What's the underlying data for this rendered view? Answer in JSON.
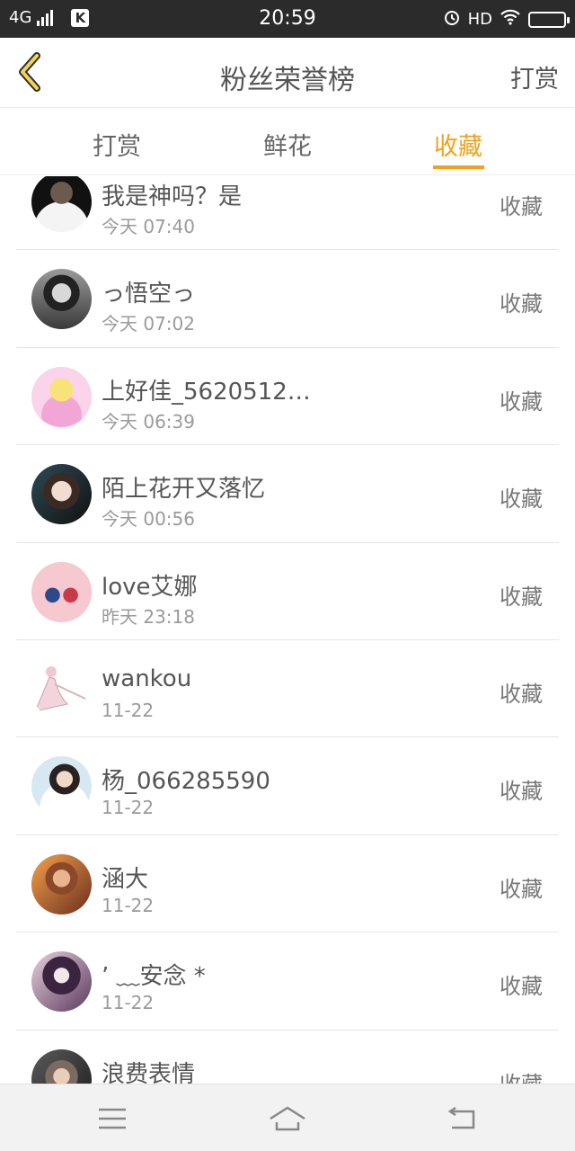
{
  "status_bar": {
    "network": "4G",
    "time": "20:59",
    "hd": "HD",
    "icons": [
      "signal-icon",
      "k-app-icon",
      "alarm-icon",
      "wifi-icon",
      "battery-icon"
    ],
    "k_label": "K"
  },
  "header": {
    "title": "粉丝荣誉榜",
    "right_action": "打赏",
    "back_icon": "chevron-left-icon"
  },
  "tabs": {
    "items": [
      {
        "label": "打赏"
      },
      {
        "label": "鲜花"
      },
      {
        "label": "收藏"
      }
    ],
    "active_index": 2
  },
  "list": {
    "rows": [
      {
        "name": "我是神吗？是",
        "time": "今天 07:40",
        "action": "收藏"
      },
      {
        "name": "っ悟空っ",
        "time": "今天 07:02",
        "action": "收藏"
      },
      {
        "name": "上好佳_5620512…",
        "time": "今天 06:39",
        "action": "收藏"
      },
      {
        "name": "陌上花开又落忆",
        "time": "今天 00:56",
        "action": "收藏"
      },
      {
        "name": "love艾娜",
        "time": "昨天 23:18",
        "action": "收藏"
      },
      {
        "name": "wankou",
        "time": "11-22",
        "action": "收藏"
      },
      {
        "name": "杨_066285590",
        "time": "11-22",
        "action": "收藏"
      },
      {
        "name": "涵大",
        "time": "11-22",
        "action": "收藏"
      },
      {
        "name": "’  ﹏安念 *",
        "time": "11-22",
        "action": "收藏"
      },
      {
        "name": "浪费表情",
        "time": "",
        "action": "收藏"
      }
    ]
  },
  "bottom_nav": {
    "icons": [
      "menu-icon",
      "home-icon",
      "back-icon"
    ]
  },
  "colors": {
    "accent": "#f0a21e",
    "status_bar": "#2b2b2b",
    "bottom_nav": "#f2f2f2"
  }
}
